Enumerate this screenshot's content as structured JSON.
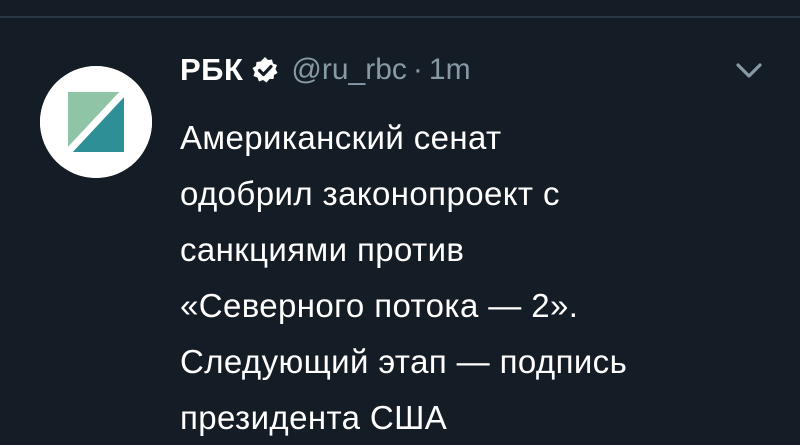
{
  "tweet": {
    "author": {
      "display_name": "РБК",
      "handle": "@ru_rbc",
      "verified_icon": "verified-badge-icon",
      "avatar_icon": "rbc-logo-icon"
    },
    "separator": "·",
    "time": "1m",
    "text_lines": [
      "Американский сенат",
      "одобрил законопроект с",
      "санкциями против",
      "«Северного потока — 2».",
      "Следующий этап — подпись",
      "президента США"
    ],
    "menu_icon": "chevron-down-icon"
  },
  "colors": {
    "background": "#141d26",
    "text": "#ffffff",
    "muted": "#8899a6",
    "logo_teal": "#2f8f96",
    "logo_green": "#8fc4a6"
  }
}
